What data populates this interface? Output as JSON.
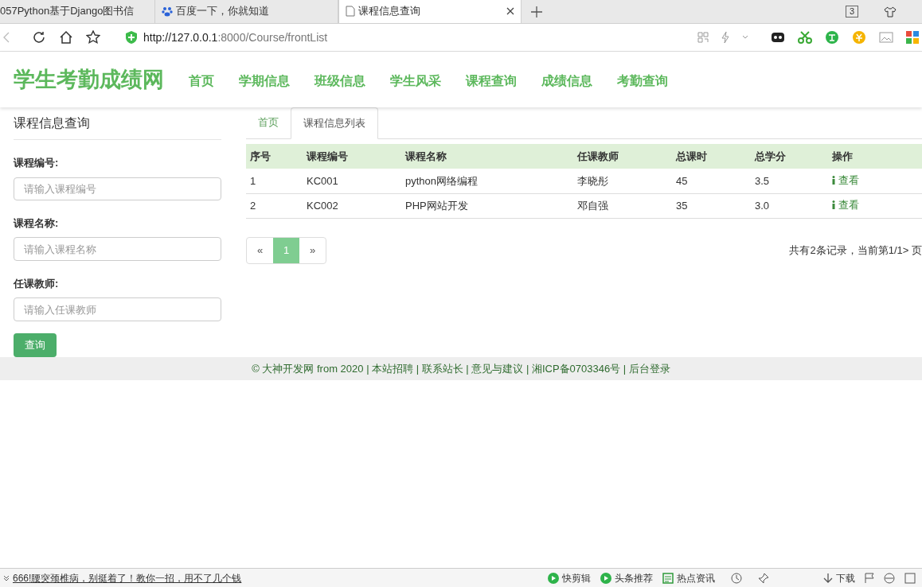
{
  "browser": {
    "tabs": [
      {
        "title": "057Python基于Django图书信",
        "selected": false,
        "kind": "plain"
      },
      {
        "title": "百度一下，你就知道",
        "selected": false,
        "kind": "site"
      },
      {
        "title": "课程信息查询",
        "selected": true,
        "kind": "page"
      }
    ],
    "tab_count": "3",
    "url_host": "http://127.0.0.1",
    "url_rest": ":8000/Course/frontList"
  },
  "site": {
    "logo": "学生考勤成绩网",
    "nav": [
      "首页",
      "学期信息",
      "班级信息",
      "学生风采",
      "课程查询",
      "成绩信息",
      "考勤查询"
    ]
  },
  "search_panel": {
    "title": "课程信息查询",
    "fields": [
      {
        "label": "课程编号:",
        "placeholder": "请输入课程编号"
      },
      {
        "label": "课程名称:",
        "placeholder": "请输入课程名称"
      },
      {
        "label": "任课教师:",
        "placeholder": "请输入任课教师"
      }
    ],
    "button": "查询"
  },
  "content_tabs": [
    {
      "label": "首页",
      "selected": false
    },
    {
      "label": "课程信息列表",
      "selected": true
    }
  ],
  "table": {
    "columns": [
      "序号",
      "课程编号",
      "课程名称",
      "任课教师",
      "总课时",
      "总学分",
      "操作"
    ],
    "rows": [
      [
        "1",
        "KC001",
        "python网络编程",
        "李晓彤",
        "45",
        "3.5",
        "查看"
      ],
      [
        "2",
        "KC002",
        "PHP网站开发",
        "邓自强",
        "35",
        "3.0",
        "查看"
      ]
    ]
  },
  "pagination": {
    "prev": "«",
    "pages": [
      {
        "label": "1",
        "selected": true
      }
    ],
    "next": "»",
    "summary": "共有2条记录，当前第1/1> 页"
  },
  "footer": "© 大神开发网 from 2020 | 本站招聘 | 联系站长 | 意见与建议 | 湘ICP备0703346号 | 后台登录",
  "status_bar": {
    "news": "666!腰突颈椎病，别挺着了！教你一招，用不了几个钱",
    "items": [
      {
        "label": "快剪辑",
        "kind": "play"
      },
      {
        "label": "头条推荐",
        "kind": "play"
      },
      {
        "label": "热点资讯",
        "kind": "news"
      },
      {
        "label": "下载",
        "kind": "download"
      }
    ]
  }
}
